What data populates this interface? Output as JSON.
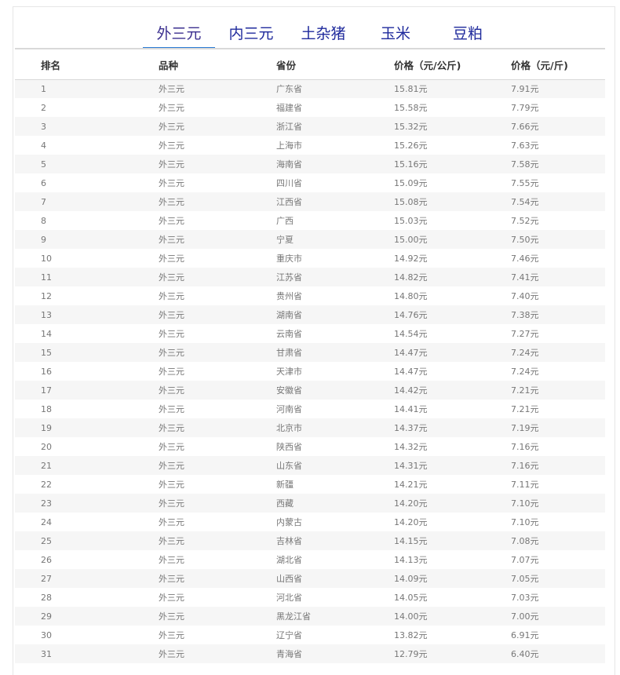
{
  "tabs": [
    {
      "label": "外三元",
      "active": true
    },
    {
      "label": "内三元",
      "active": false
    },
    {
      "label": "土杂猪",
      "active": false
    },
    {
      "label": "玉米",
      "active": false
    },
    {
      "label": "豆粕",
      "active": false
    }
  ],
  "table": {
    "headers": [
      "排名",
      "品种",
      "省份",
      "价格（元/公斤)",
      "价格（元/斤)"
    ],
    "rows": [
      [
        "1",
        "外三元",
        "广东省",
        "15.81元",
        "7.91元"
      ],
      [
        "2",
        "外三元",
        "福建省",
        "15.58元",
        "7.79元"
      ],
      [
        "3",
        "外三元",
        "浙江省",
        "15.32元",
        "7.66元"
      ],
      [
        "4",
        "外三元",
        "上海市",
        "15.26元",
        "7.63元"
      ],
      [
        "5",
        "外三元",
        "海南省",
        "15.16元",
        "7.58元"
      ],
      [
        "6",
        "外三元",
        "四川省",
        "15.09元",
        "7.55元"
      ],
      [
        "7",
        "外三元",
        "江西省",
        "15.08元",
        "7.54元"
      ],
      [
        "8",
        "外三元",
        "广西",
        "15.03元",
        "7.52元"
      ],
      [
        "9",
        "外三元",
        "宁夏",
        "15.00元",
        "7.50元"
      ],
      [
        "10",
        "外三元",
        "重庆市",
        "14.92元",
        "7.46元"
      ],
      [
        "11",
        "外三元",
        "江苏省",
        "14.82元",
        "7.41元"
      ],
      [
        "12",
        "外三元",
        "贵州省",
        "14.80元",
        "7.40元"
      ],
      [
        "13",
        "外三元",
        "湖南省",
        "14.76元",
        "7.38元"
      ],
      [
        "14",
        "外三元",
        "云南省",
        "14.54元",
        "7.27元"
      ],
      [
        "15",
        "外三元",
        "甘肃省",
        "14.47元",
        "7.24元"
      ],
      [
        "16",
        "外三元",
        "天津市",
        "14.47元",
        "7.24元"
      ],
      [
        "17",
        "外三元",
        "安徽省",
        "14.42元",
        "7.21元"
      ],
      [
        "18",
        "外三元",
        "河南省",
        "14.41元",
        "7.21元"
      ],
      [
        "19",
        "外三元",
        "北京市",
        "14.37元",
        "7.19元"
      ],
      [
        "20",
        "外三元",
        "陕西省",
        "14.32元",
        "7.16元"
      ],
      [
        "21",
        "外三元",
        "山东省",
        "14.31元",
        "7.16元"
      ],
      [
        "22",
        "外三元",
        "新疆",
        "14.21元",
        "7.11元"
      ],
      [
        "23",
        "外三元",
        "西藏",
        "14.20元",
        "7.10元"
      ],
      [
        "24",
        "外三元",
        "内蒙古",
        "14.20元",
        "7.10元"
      ],
      [
        "25",
        "外三元",
        "吉林省",
        "14.15元",
        "7.08元"
      ],
      [
        "26",
        "外三元",
        "湖北省",
        "14.13元",
        "7.07元"
      ],
      [
        "27",
        "外三元",
        "山西省",
        "14.09元",
        "7.05元"
      ],
      [
        "28",
        "外三元",
        "河北省",
        "14.05元",
        "7.03元"
      ],
      [
        "29",
        "外三元",
        "黑龙江省",
        "14.00元",
        "7.00元"
      ],
      [
        "30",
        "外三元",
        "辽宁省",
        "13.82元",
        "6.91元"
      ],
      [
        "31",
        "外三元",
        "青海省",
        "12.79元",
        "6.40元"
      ]
    ]
  }
}
